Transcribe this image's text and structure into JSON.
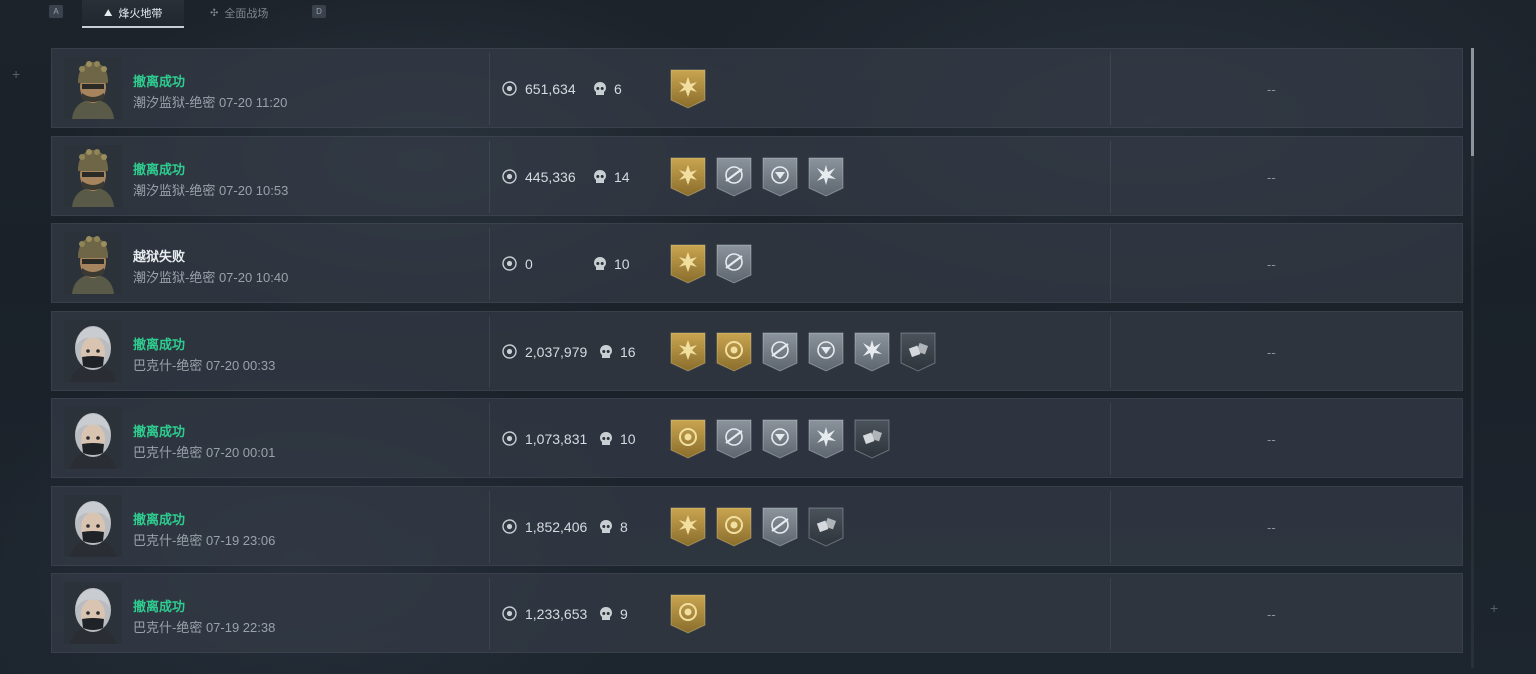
{
  "tabs": {
    "left_key": "A",
    "right_key": "D",
    "items": [
      {
        "label": "烽火地带",
        "icon": "fire-zone-icon",
        "active": true
      },
      {
        "label": "全面战场",
        "icon": "battlefield-icon",
        "active": false
      }
    ]
  },
  "colors": {
    "success": "#2ecc8f",
    "fail": "#e8ecef",
    "badge_gold": "#b08d3a",
    "badge_silver": "#7c868f",
    "badge_dark": "#3b4149"
  },
  "records": [
    {
      "operator": "soldier",
      "status": "撤离成功",
      "success": true,
      "map": "潮汐监狱-绝密 07-20 11:20",
      "value": "651,634",
      "kills": "6",
      "badges": [
        {
          "type": "gold",
          "icon": "star-burst-icon"
        }
      ],
      "extra": "--"
    },
    {
      "operator": "soldier",
      "status": "撤离成功",
      "success": true,
      "map": "潮汐监狱-绝密 07-20 10:53",
      "value": "445,336",
      "kills": "14",
      "badges": [
        {
          "type": "gold",
          "icon": "star-burst-icon"
        },
        {
          "type": "silver",
          "icon": "crosshair-rifle-icon"
        },
        {
          "type": "silver",
          "icon": "crosshair-emblem-icon"
        },
        {
          "type": "silver",
          "icon": "burst-icon"
        }
      ],
      "extra": "--"
    },
    {
      "operator": "soldier",
      "status": "越狱失败",
      "success": false,
      "map": "潮汐监狱-绝密 07-20 10:40",
      "value": "0",
      "kills": "10",
      "badges": [
        {
          "type": "gold",
          "icon": "star-burst-icon"
        },
        {
          "type": "silver",
          "icon": "crosshair-rifle-icon"
        }
      ],
      "extra": "--"
    },
    {
      "operator": "girl",
      "status": "撤离成功",
      "success": true,
      "map": "巴克什-绝密 07-20 00:33",
      "value": "2,037,979",
      "kills": "16",
      "badges": [
        {
          "type": "gold",
          "icon": "star-burst-icon"
        },
        {
          "type": "gold",
          "icon": "coin-target-icon"
        },
        {
          "type": "silver",
          "icon": "crosshair-rifle-icon"
        },
        {
          "type": "silver",
          "icon": "crosshair-emblem-icon"
        },
        {
          "type": "silver",
          "icon": "burst-icon"
        },
        {
          "type": "dark",
          "icon": "loot-icon"
        }
      ],
      "extra": "--"
    },
    {
      "operator": "girl",
      "status": "撤离成功",
      "success": true,
      "map": "巴克什-绝密 07-20 00:01",
      "value": "1,073,831",
      "kills": "10",
      "badges": [
        {
          "type": "gold",
          "icon": "coin-target-icon"
        },
        {
          "type": "silver",
          "icon": "crosshair-rifle-icon"
        },
        {
          "type": "silver",
          "icon": "crosshair-emblem-icon"
        },
        {
          "type": "silver",
          "icon": "burst-icon"
        },
        {
          "type": "dark",
          "icon": "loot-icon"
        }
      ],
      "extra": "--"
    },
    {
      "operator": "girl",
      "status": "撤离成功",
      "success": true,
      "map": "巴克什-绝密 07-19 23:06",
      "value": "1,852,406",
      "kills": "8",
      "badges": [
        {
          "type": "gold",
          "icon": "star-burst-icon"
        },
        {
          "type": "gold",
          "icon": "coin-target-icon"
        },
        {
          "type": "silver",
          "icon": "crosshair-rifle-icon"
        },
        {
          "type": "dark",
          "icon": "loot-icon"
        }
      ],
      "extra": "--"
    },
    {
      "operator": "girl",
      "status": "撤离成功",
      "success": true,
      "map": "巴克什-绝密 07-19 22:38",
      "value": "1,233,653",
      "kills": "9",
      "badges": [
        {
          "type": "gold",
          "icon": "coin-target-icon"
        }
      ],
      "extra": "--"
    }
  ]
}
